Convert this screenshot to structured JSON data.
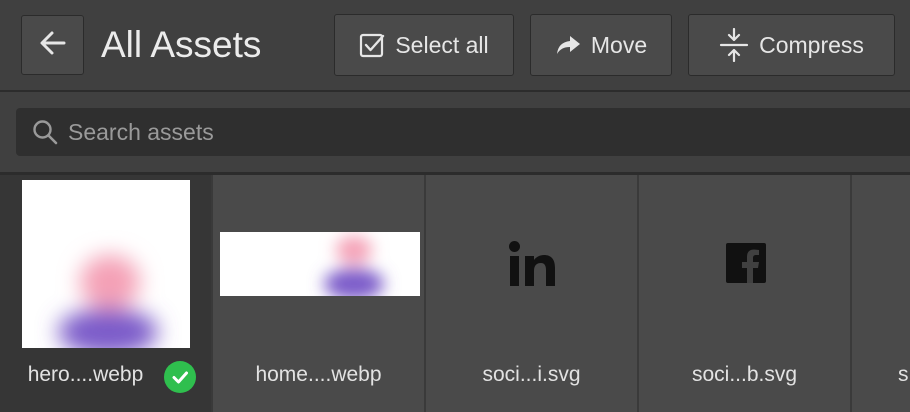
{
  "header": {
    "title": "All Assets",
    "back_icon": "arrow-left-icon",
    "buttons": {
      "select_all": "Select all",
      "move": "Move",
      "compress": "Compress"
    }
  },
  "search": {
    "placeholder": "Search assets",
    "value": ""
  },
  "assets": [
    {
      "name": "hero....webp",
      "selected": true,
      "kind": "image"
    },
    {
      "name": "home....webp",
      "selected": false,
      "kind": "image"
    },
    {
      "name": "soci...i.svg",
      "selected": false,
      "kind": "linkedin-logo"
    },
    {
      "name": "soci...b.svg",
      "selected": false,
      "kind": "facebook-logo"
    },
    {
      "name": "s",
      "selected": false,
      "kind": "partial"
    }
  ],
  "colors": {
    "background": "#404040",
    "button": "#4a4a4a",
    "selected_tile": "#363636",
    "check_badge": "#2fbf4e"
  }
}
